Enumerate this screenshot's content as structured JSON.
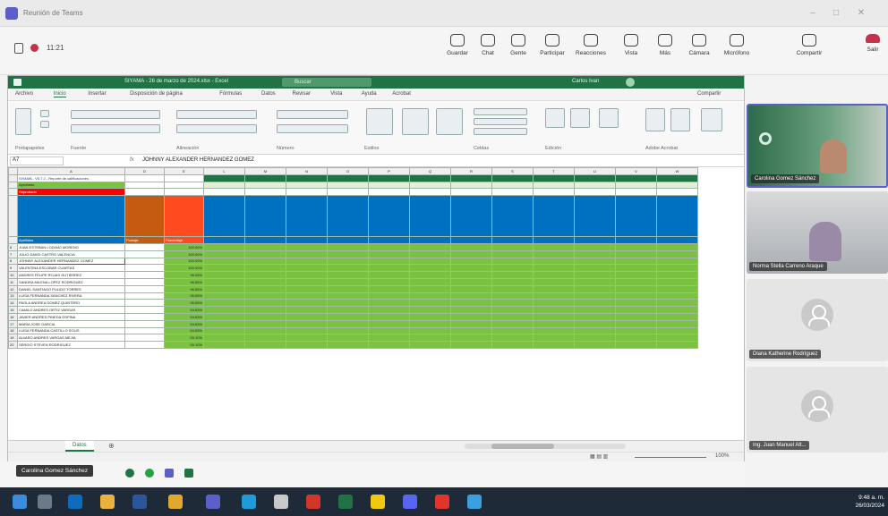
{
  "window": {
    "title": "Reunión de Teams"
  },
  "meeting": {
    "time": "11:21",
    "toolbar": [
      {
        "name": "guardar-button",
        "icon": "save-icon",
        "label": "Guardar"
      },
      {
        "name": "chat-button",
        "icon": "chat-icon",
        "label": "Chat"
      },
      {
        "name": "gente-button",
        "icon": "people-icon",
        "label": "Gente"
      },
      {
        "name": "reaccionar-button",
        "icon": "hand-icon",
        "label": "Participar"
      },
      {
        "name": "reacciones-button",
        "icon": "smile-icon",
        "label": "Reacciones"
      },
      {
        "name": "vista-button",
        "icon": "grid-icon",
        "label": "Vista"
      },
      {
        "name": "mas-button",
        "icon": "more-icon",
        "label": "Más"
      },
      {
        "name": "camara-button",
        "icon": "camera-icon",
        "label": "Cámara"
      },
      {
        "name": "microfono-button",
        "icon": "mic-icon",
        "label": "Micrófono"
      },
      {
        "name": "compartir-button",
        "icon": "share-icon",
        "label": "Compartir"
      }
    ],
    "leave_label": "Salir"
  },
  "excel": {
    "title": "SIYAMA - 26 de marzo de 2024.xlsx - Excel",
    "search_placeholder": "Buscar",
    "user": "Carlos Ivan",
    "tabs": [
      "Archivo",
      "Inicio",
      "Insertar",
      "Disposición de página",
      "Fórmulas",
      "Datos",
      "Revisar",
      "Vista",
      "Ayuda",
      "Acrobat"
    ],
    "share_label": "Compartir",
    "ribbon_groups": [
      "Portapapeles",
      "Fuente",
      "Alineación",
      "Número",
      "Estilos",
      "Celdas",
      "Edición",
      "Adobe Acrobat"
    ],
    "cell_ref": "A7",
    "fx": "fx",
    "formula": "JOHNNY ALEXANDER HERNANDEZ GOMEZ",
    "col_headers": [
      "A",
      "D",
      "E",
      "L",
      "M",
      "N",
      "O",
      "P",
      "Q",
      "R",
      "S",
      "T",
      "U",
      "V",
      "W"
    ],
    "header_title": "SIYAMA - V5.7.2 - Reporte de calificaciones",
    "row1_a": "Aprobado",
    "row2_a": "Reprobado",
    "col_label_a": "Apellidos",
    "col_label_d": "Puntaje",
    "col_label_e": "Porcentaje",
    "students": [
      {
        "n": "6",
        "name": "JUAN ESTEBAN LOZANO MORENO",
        "pct": "100.00%"
      },
      {
        "n": "7",
        "name": "JULIO DAVID CASTRO VALENCIA",
        "pct": "100.00%"
      },
      {
        "n": "8",
        "name": "JOHNNY ALEXANDER HERNANDEZ GOMEZ",
        "pct": "100.00%"
      },
      {
        "n": "9",
        "name": "VALENTINA ESCOBAR CUARTAS",
        "pct": "100.00%"
      },
      {
        "n": "10",
        "name": "ANDRES FELIPE ROJAS GUTIERREZ",
        "pct": "98.28%"
      },
      {
        "n": "11",
        "name": "SANDRA MILENA LOPEZ RODRIGUEZ",
        "pct": "96.55%"
      },
      {
        "n": "12",
        "name": "DANIEL SANTIAGO PULIDO TORRES",
        "pct": "96.55%"
      },
      {
        "n": "13",
        "name": "LUISA FERNANDA SANCHEZ RIVERA",
        "pct": "96.55%"
      },
      {
        "n": "14",
        "name": "PAOLA ANDREA GOMEZ QUINTERO",
        "pct": "96.55%"
      },
      {
        "n": "15",
        "name": "CAMILO ANDRES ORTIZ VARGAS",
        "pct": "94.83%"
      },
      {
        "n": "16",
        "name": "JAVIER ANDRES PINEDA OSPINA",
        "pct": "94.83%"
      },
      {
        "n": "17",
        "name": "MARIA JOSE GARCIA",
        "pct": "94.83%"
      },
      {
        "n": "18",
        "name": "LUISA FERNANDA CASTILLO SOLIS",
        "pct": "94.83%"
      },
      {
        "n": "19",
        "name": "ALVARO ANDRES VARGAS MEJIA",
        "pct": "93.10%"
      },
      {
        "n": "20",
        "name": "SERGIO STEVEN RODRIGUEZ",
        "pct": "93.10%"
      }
    ],
    "sheet_tab": "Datos",
    "zoom": "100%"
  },
  "participants": [
    {
      "name": "Carolina Gomez Sánchez"
    },
    {
      "name": "Norma Stella Carreno Araque"
    },
    {
      "name": "Diana Katherine Rodríguez"
    },
    {
      "name": "Ing. Juan Manuel Alt..."
    }
  ],
  "presenter": "Carolina Gomez Sánchez",
  "taskbar": {
    "time": "9:48 a. m.",
    "date": "26/03/2024"
  },
  "colors": {
    "excel_green": "#217346",
    "cell_green": "#7cc242",
    "header_blue": "#0070c0",
    "accent_orange": "#ed7d31",
    "accent_red": "#ff0000",
    "teams_purple": "#5b5fc7"
  }
}
